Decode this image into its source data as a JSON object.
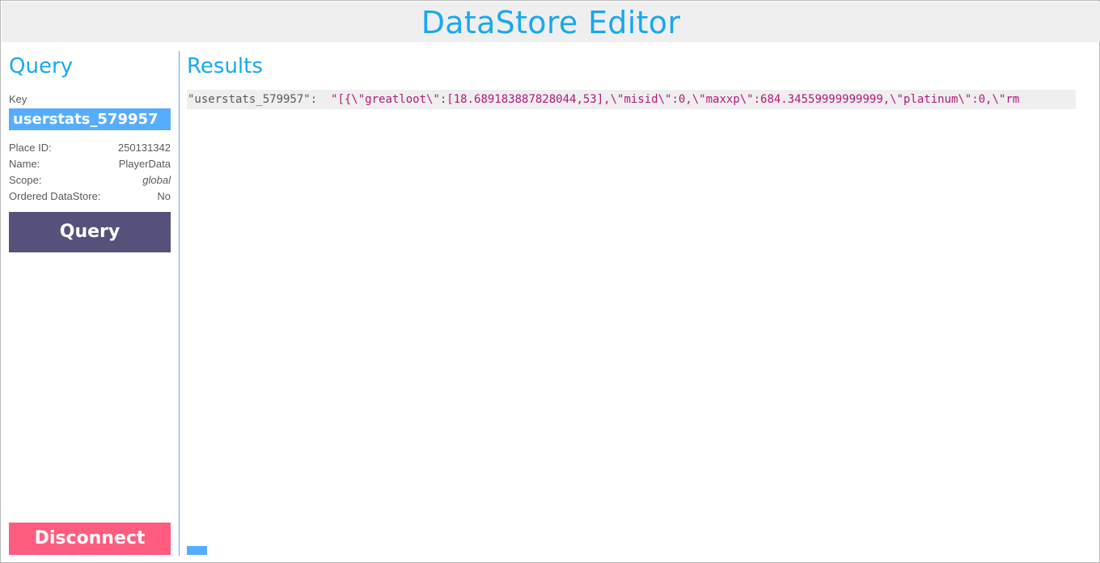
{
  "app": {
    "title": "DataStore Editor"
  },
  "sidebar": {
    "heading": "Query",
    "key_label": "Key",
    "key_value": "userstats_579957",
    "info": {
      "place_id_label": "Place ID:",
      "place_id_value": "250131342",
      "name_label": "Name:",
      "name_value": "PlayerData",
      "scope_label": "Scope:",
      "scope_value": "global",
      "ordered_label": "Ordered DataStore:",
      "ordered_value": "No"
    },
    "query_button": "Query",
    "disconnect_button": "Disconnect"
  },
  "results": {
    "heading": "Results",
    "rows": [
      {
        "key": "\"userstats_579957\":",
        "value": "\"[{\\\"greatloot\\\":[18.689183887828044,53],\\\"misid\\\":0,\\\"maxxp\\\":684.34559999999999,\\\"platinum\\\":0,\\\"rm"
      }
    ]
  },
  "colors": {
    "accent": "#19a8ef",
    "input_bg": "#56adff",
    "query_button": "#55517b",
    "disconnect_button": "#ff5c7f",
    "result_value": "#b5177f",
    "title_bar": "#efefef"
  }
}
